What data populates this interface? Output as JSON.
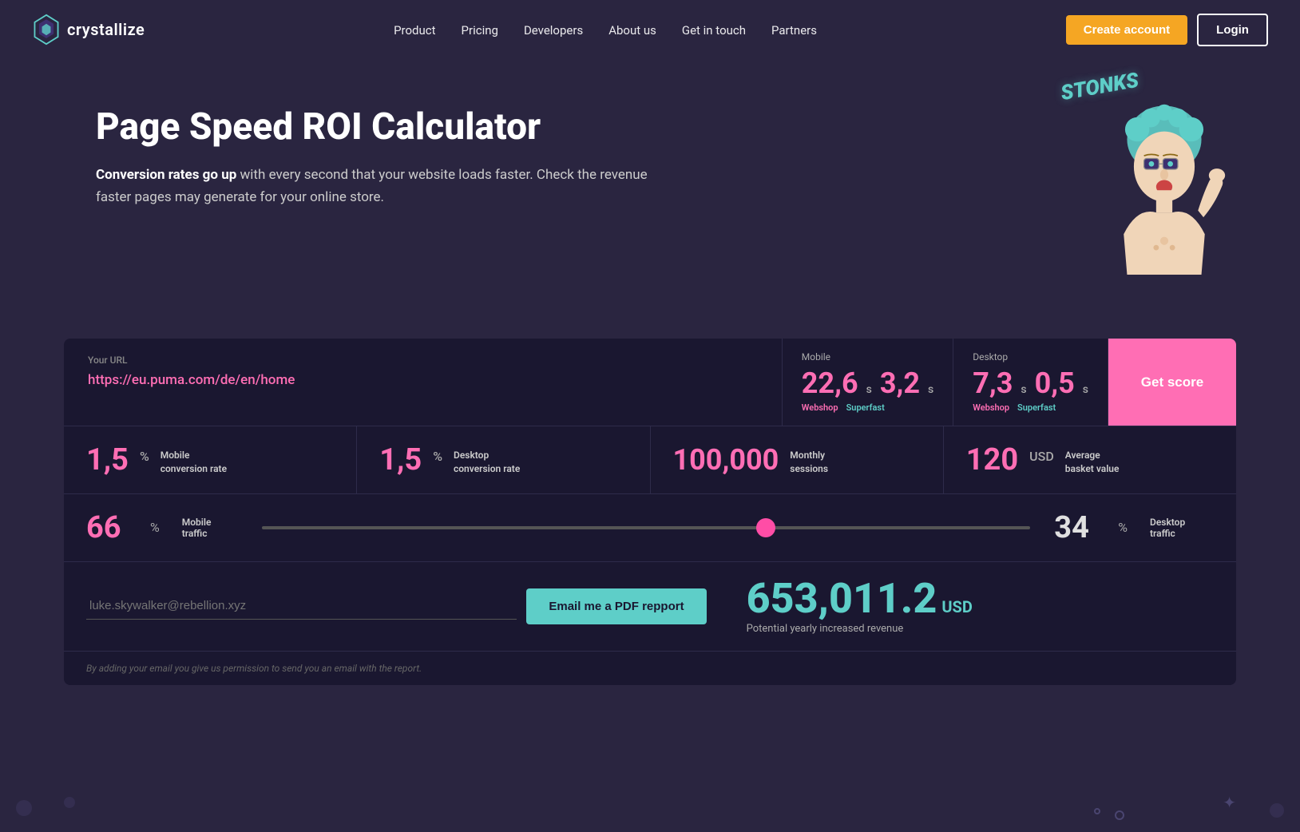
{
  "brand": {
    "name": "crystallize",
    "logo_alt": "Crystallize logo"
  },
  "nav": {
    "links": [
      {
        "label": "Product",
        "href": "#"
      },
      {
        "label": "Pricing",
        "href": "#"
      },
      {
        "label": "Developers",
        "href": "#"
      },
      {
        "label": "About us",
        "href": "#"
      },
      {
        "label": "Get in touch",
        "href": "#"
      },
      {
        "label": "Partners",
        "href": "#"
      }
    ],
    "create_account": "Create account",
    "login": "Login"
  },
  "hero": {
    "title": "Page Speed ROI Calculator",
    "subtitle_bold": "Conversion rates go up",
    "subtitle_rest": " with every second that your website loads faster. Check the revenue faster pages may generate for your online store.",
    "stonks_label": "STONKS"
  },
  "calculator": {
    "url_label": "Your URL",
    "url_value": "https://eu.puma.com/de/en/home",
    "mobile_label": "Mobile",
    "desktop_label": "Desktop",
    "mobile_webshop": "22,6",
    "mobile_superfast": "3,2",
    "desktop_webshop": "7,3",
    "desktop_superfast": "0,5",
    "score_unit": "s",
    "webshop_tag": "Webshop",
    "superfast_tag": "Superfast",
    "get_score_btn": "Get score",
    "mobile_cr_value": "1,5",
    "mobile_cr_unit": "%",
    "mobile_cr_label": "Mobile\nconversion rate",
    "desktop_cr_value": "1,5",
    "desktop_cr_unit": "%",
    "desktop_cr_label": "Desktop\nconversion rate",
    "sessions_value": "100,000",
    "sessions_label": "Monthly\nsessions",
    "basket_value": "120",
    "basket_unit": "USD",
    "basket_label": "Average\nbasket value",
    "mobile_traffic": "66",
    "mobile_traffic_unit": "%",
    "mobile_traffic_label": "Mobile\ntraffic",
    "desktop_traffic": "34",
    "desktop_traffic_unit": "%",
    "desktop_traffic_label": "Desktop\ntraffic",
    "slider_value": 66,
    "email_placeholder": "luke.skywalker@rebellion.xyz",
    "email_btn": "Email me a PDF repport",
    "revenue_amount": "653,011.2",
    "revenue_unit": "USD",
    "revenue_label": "Potential yearly increased revenue",
    "disclaimer": "By adding your email you give us permission to send you an email with the report."
  },
  "colors": {
    "pink": "#ff6eb4",
    "teal": "#5ecec8",
    "bg_dark": "#2a2540",
    "card_bg": "#1a1730",
    "orange": "#f5a623"
  }
}
